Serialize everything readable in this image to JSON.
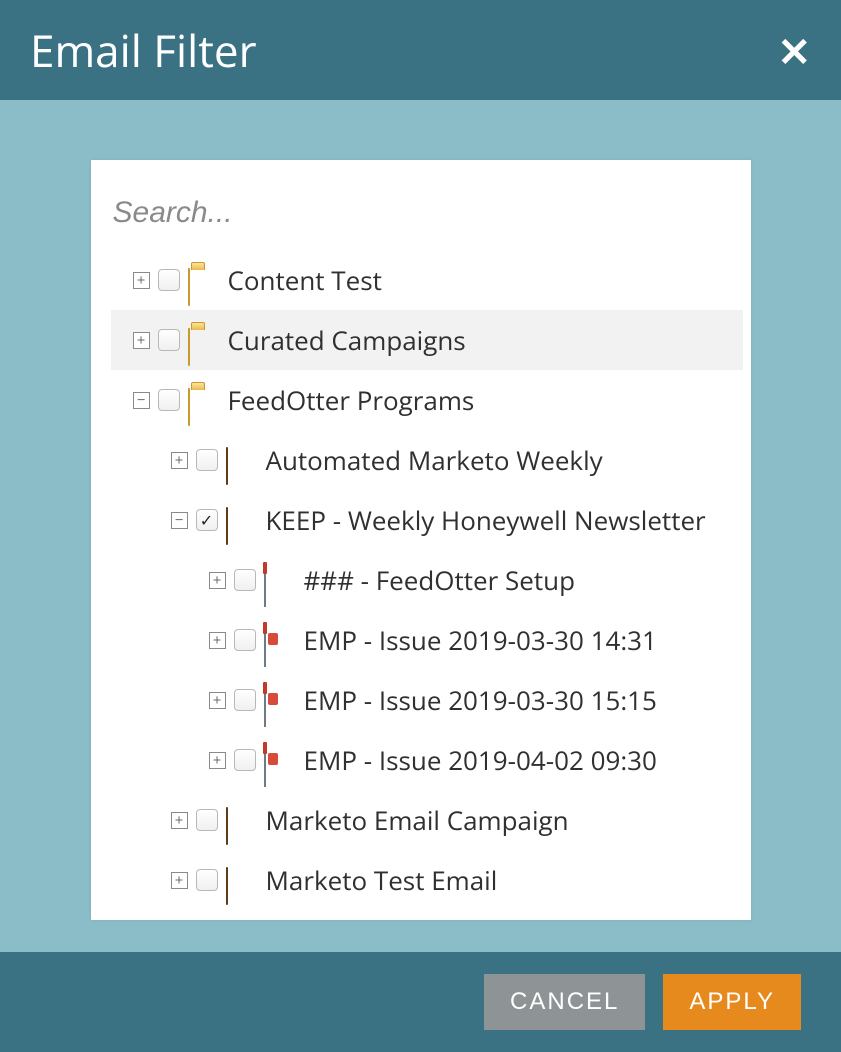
{
  "dialog": {
    "title": "Email Filter",
    "close_label": "✕"
  },
  "search": {
    "placeholder": "Search...",
    "value": ""
  },
  "tree": {
    "items": [
      {
        "indent": 1,
        "expander": "+",
        "checked": false,
        "icon": "folder",
        "label": "Content Test",
        "hover": false
      },
      {
        "indent": 1,
        "expander": "+",
        "checked": false,
        "icon": "folder",
        "label": "Curated Campaigns",
        "hover": true
      },
      {
        "indent": 1,
        "expander": "−",
        "checked": false,
        "icon": "folder",
        "label": "FeedOtter Programs",
        "hover": false
      },
      {
        "indent": 2,
        "expander": "+",
        "checked": false,
        "icon": "bag",
        "label": "Automated Marketo Weekly",
        "hover": false
      },
      {
        "indent": 2,
        "expander": "−",
        "checked": true,
        "icon": "bag",
        "label": "KEEP - Weekly Honeywell Newsletter",
        "hover": false
      },
      {
        "indent": 3,
        "expander": "+",
        "checked": false,
        "icon": "mailbox",
        "label": "### - FeedOtter Setup",
        "hover": false
      },
      {
        "indent": 3,
        "expander": "+",
        "checked": false,
        "icon": "mailbox-red",
        "label": "EMP - Issue 2019-03-30 14:31",
        "hover": false
      },
      {
        "indent": 3,
        "expander": "+",
        "checked": false,
        "icon": "mailbox-red",
        "label": "EMP - Issue 2019-03-30 15:15",
        "hover": false
      },
      {
        "indent": 3,
        "expander": "+",
        "checked": false,
        "icon": "mailbox-red",
        "label": "EMP - Issue 2019-04-02 09:30",
        "hover": false
      },
      {
        "indent": 2,
        "expander": "+",
        "checked": false,
        "icon": "bag",
        "label": "Marketo Email Campaign",
        "hover": false
      },
      {
        "indent": 2,
        "expander": "+",
        "checked": false,
        "icon": "bag",
        "label": "Marketo Test Email",
        "hover": false
      }
    ]
  },
  "footer": {
    "cancel": "CANCEL",
    "apply": "APPLY"
  }
}
